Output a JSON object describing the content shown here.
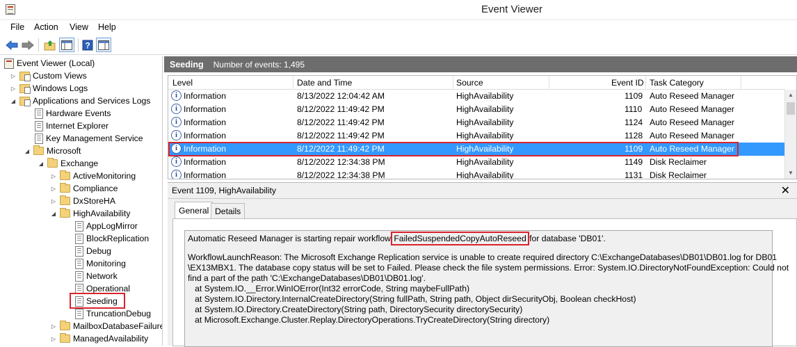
{
  "window": {
    "title": "Event Viewer"
  },
  "menu": [
    "File",
    "Action",
    "View",
    "Help"
  ],
  "tree": {
    "items": [
      {
        "label": "Event Viewer (Local)",
        "icon": "event-viewer-icon",
        "expander": "none"
      },
      {
        "label": "Custom Views",
        "icon": "folder-icon",
        "expander": "collapsed"
      },
      {
        "label": "Windows Logs",
        "icon": "folder-icon",
        "expander": "collapsed"
      },
      {
        "label": "Applications and Services Logs",
        "icon": "folder-icon",
        "expander": "expanded"
      },
      {
        "label": "Hardware Events",
        "icon": "log-icon",
        "expander": "none"
      },
      {
        "label": "Internet Explorer",
        "icon": "log-icon",
        "expander": "none"
      },
      {
        "label": "Key Management Service",
        "icon": "log-icon",
        "expander": "none"
      },
      {
        "label": "Microsoft",
        "icon": "folder-icon",
        "expander": "expanded"
      },
      {
        "label": "Exchange",
        "icon": "folder-icon",
        "expander": "expanded"
      },
      {
        "label": "ActiveMonitoring",
        "icon": "folder-icon",
        "expander": "collapsed"
      },
      {
        "label": "Compliance",
        "icon": "folder-icon",
        "expander": "collapsed"
      },
      {
        "label": "DxStoreHA",
        "icon": "folder-icon",
        "expander": "collapsed"
      },
      {
        "label": "HighAvailability",
        "icon": "folder-icon",
        "expander": "expanded"
      },
      {
        "label": "AppLogMirror",
        "icon": "log-icon",
        "expander": "none"
      },
      {
        "label": "BlockReplication",
        "icon": "log-icon",
        "expander": "none"
      },
      {
        "label": "Debug",
        "icon": "log-icon",
        "expander": "none"
      },
      {
        "label": "Monitoring",
        "icon": "log-icon",
        "expander": "none"
      },
      {
        "label": "Network",
        "icon": "log-icon",
        "expander": "none"
      },
      {
        "label": "Operational",
        "icon": "log-icon",
        "expander": "none"
      },
      {
        "label": "Seeding",
        "icon": "log-icon",
        "expander": "none"
      },
      {
        "label": "TruncationDebug",
        "icon": "log-icon",
        "expander": "none"
      },
      {
        "label": "MailboxDatabaseFailure",
        "icon": "folder-icon",
        "expander": "collapsed"
      },
      {
        "label": "ManagedAvailability",
        "icon": "folder-icon",
        "expander": "collapsed"
      }
    ]
  },
  "log_header": {
    "name": "Seeding",
    "count": "Number of events: 1,495"
  },
  "columns": [
    "Level",
    "Date and Time",
    "Source",
    "Event ID",
    "Task Category"
  ],
  "events": [
    {
      "level": "Information",
      "datetime": "8/13/2022 12:04:42 AM",
      "source": "HighAvailability",
      "event_id": "1109",
      "task": "Auto Reseed Manager"
    },
    {
      "level": "Information",
      "datetime": "8/12/2022 11:49:42 PM",
      "source": "HighAvailability",
      "event_id": "1110",
      "task": "Auto Reseed Manager"
    },
    {
      "level": "Information",
      "datetime": "8/12/2022 11:49:42 PM",
      "source": "HighAvailability",
      "event_id": "1124",
      "task": "Auto Reseed Manager"
    },
    {
      "level": "Information",
      "datetime": "8/12/2022 11:49:42 PM",
      "source": "HighAvailability",
      "event_id": "1128",
      "task": "Auto Reseed Manager"
    },
    {
      "level": "Information",
      "datetime": "8/12/2022 11:49:42 PM",
      "source": "HighAvailability",
      "event_id": "1109",
      "task": "Auto Reseed Manager"
    },
    {
      "level": "Information",
      "datetime": "8/12/2022 12:34:38 PM",
      "source": "HighAvailability",
      "event_id": "1149",
      "task": "Disk Reclaimer"
    },
    {
      "level": "Information",
      "datetime": "8/12/2022 12:34:38 PM",
      "source": "HighAvailability",
      "event_id": "1131",
      "task": "Disk Reclaimer"
    }
  ],
  "detail": {
    "title": "Event 1109, HighAvailability",
    "tabs": [
      "General",
      "Details"
    ],
    "desc_pre": "Automatic Reseed Manager is starting repair workflow ",
    "desc_marked": "FailedSuspendedCopyAutoReseed",
    "desc_post": " for database 'DB01'.",
    "lines": [
      "WorkflowLaunchReason: The Microsoft Exchange Replication service is unable to create required directory C:\\ExchangeDatabases\\DB01\\DB01.log for DB01",
      "\\EX13MBX1. The database copy status will be set to Failed. Please check the file system permissions. Error: System.IO.DirectoryNotFoundException: Could not",
      "find a part of the path 'C:\\ExchangeDatabases\\DB01\\DB01.log'.",
      "   at System.IO.__Error.WinIOError(Int32 errorCode, String maybeFullPath)",
      "   at System.IO.Directory.InternalCreateDirectory(String fullPath, String path, Object dirSecurityObj, Boolean checkHost)",
      "   at System.IO.Directory.CreateDirectory(String path, DirectorySecurity directorySecurity)",
      "   at Microsoft.Exchange.Cluster.Replay.DirectoryOperations.TryCreateDirectory(String directory)"
    ]
  },
  "colors": {
    "selection": "#3399ff",
    "header_bar": "#6d6d6d",
    "annotation": "#d9232e"
  }
}
